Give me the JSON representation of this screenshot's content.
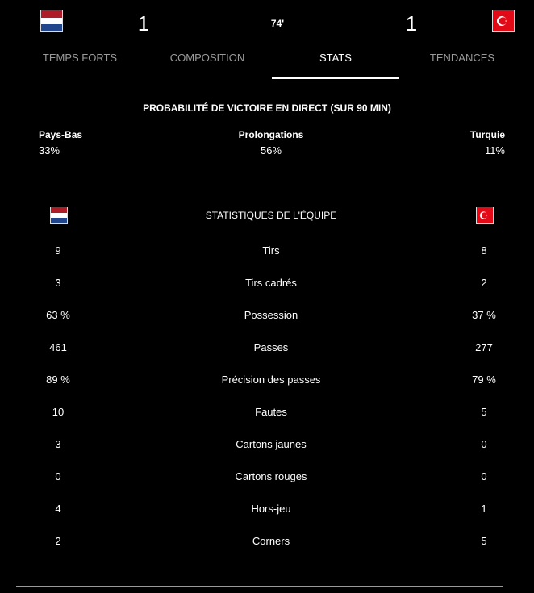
{
  "header": {
    "home_flag_icon": "netherlands-flag-icon",
    "away_flag_icon": "turkey-flag-icon",
    "home_score": "1",
    "away_score": "1",
    "minute": "74'"
  },
  "tabs": [
    {
      "label": "TEMPS FORTS",
      "active": false
    },
    {
      "label": "COMPOSITION",
      "active": false
    },
    {
      "label": "STATS",
      "active": true
    },
    {
      "label": "TENDANCES",
      "active": false
    }
  ],
  "win_probability": {
    "title": "PROBABILITÉ DE VICTOIRE EN DIRECT (SUR 90 MIN)",
    "home_label": "Pays-Bas",
    "home_value": "33%",
    "draw_label": "Prolongations",
    "draw_value": "56%",
    "away_label": "Turquie",
    "away_value": "11%"
  },
  "team_stats": {
    "title": "STATISTIQUES DE L'ÉQUIPE",
    "rows": [
      {
        "home": "9",
        "label": "Tirs",
        "away": "8"
      },
      {
        "home": "3",
        "label": "Tirs cadrés",
        "away": "2"
      },
      {
        "home": "63 %",
        "label": "Possession",
        "away": "37 %"
      },
      {
        "home": "461",
        "label": "Passes",
        "away": "277"
      },
      {
        "home": "89 %",
        "label": "Précision des passes",
        "away": "79 %"
      },
      {
        "home": "10",
        "label": "Fautes",
        "away": "5"
      },
      {
        "home": "3",
        "label": "Cartons jaunes",
        "away": "0"
      },
      {
        "home": "0",
        "label": "Cartons rouges",
        "away": "0"
      },
      {
        "home": "4",
        "label": "Hors-jeu",
        "away": "1"
      },
      {
        "home": "2",
        "label": "Corners",
        "away": "5"
      }
    ]
  },
  "colors": {
    "background": "#000000",
    "text": "#ffffff",
    "muted": "#9a9a9a",
    "nl_red": "#ae1c28",
    "nl_blue": "#21468b",
    "tr_red": "#e30a17"
  }
}
